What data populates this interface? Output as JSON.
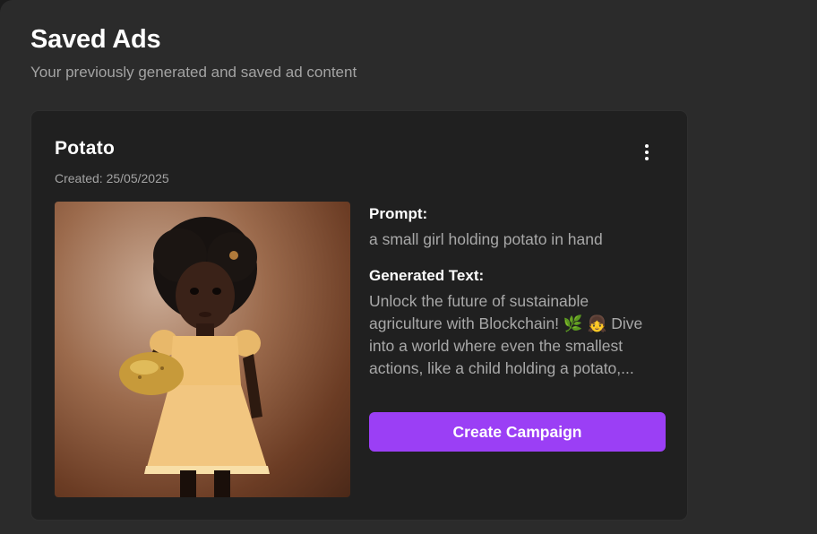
{
  "page": {
    "title": "Saved Ads",
    "subtitle": "Your previously generated and saved ad content"
  },
  "ad": {
    "title": "Potato",
    "created": "Created: 25/05/2025",
    "image_alt": "Girl in yellow dress holding a golden potato",
    "prompt_label": "Prompt:",
    "prompt": "a small girl holding potato in hand",
    "generated_label": "Generated Text:",
    "generated_text": "Unlock the future of sustainable agriculture with Blockchain! 🌿 👧 Dive into a world where even the smallest actions, like a child holding a potato,...",
    "cta_label": "Create Campaign",
    "menu_icon": "more-vertical-icon"
  },
  "colors": {
    "accent": "#9b3ff5",
    "card_bg": "#202020",
    "page_bg": "#2b2b2b"
  }
}
